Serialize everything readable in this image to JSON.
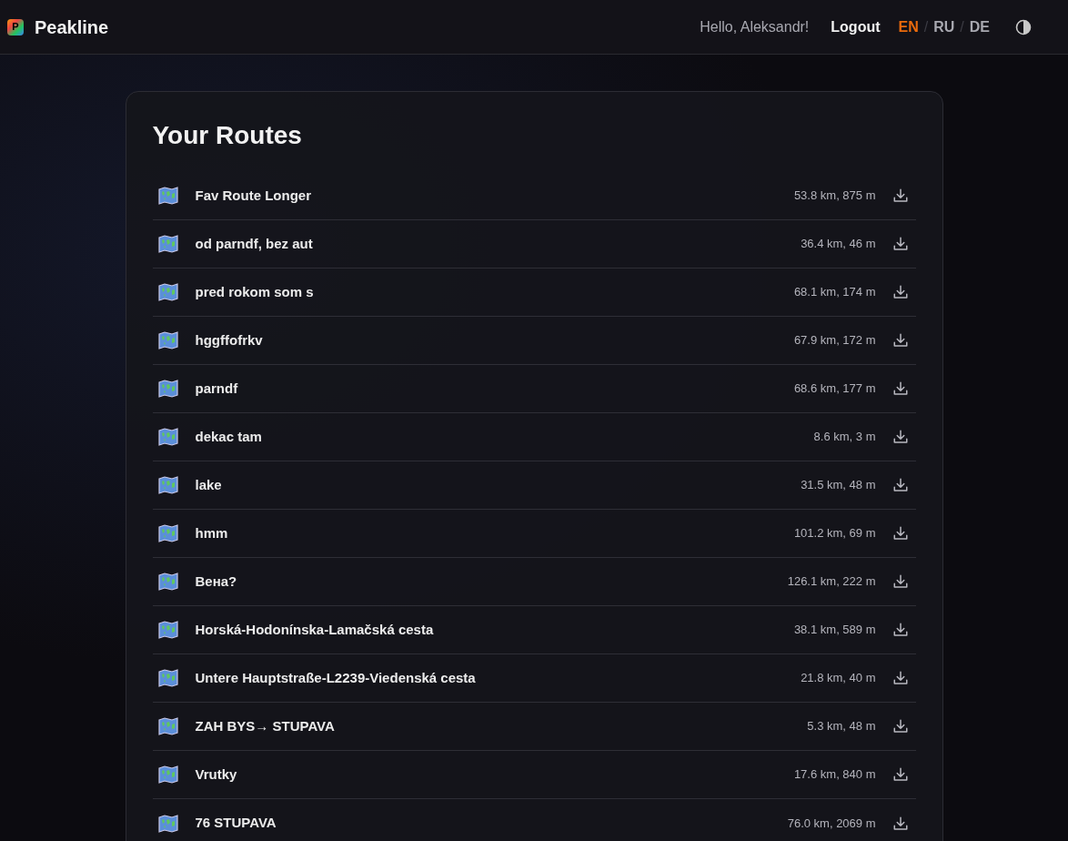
{
  "brand": {
    "name": "Peakline",
    "logo_letter": "P"
  },
  "header": {
    "greeting": "Hello, Aleksandr!",
    "logout": "Logout",
    "languages": [
      {
        "code": "EN",
        "selected": true
      },
      {
        "code": "RU",
        "selected": false
      },
      {
        "code": "DE",
        "selected": false
      }
    ],
    "language_separator": "/"
  },
  "routes": {
    "title": "Your Routes",
    "items": [
      {
        "name": "Fav Route Longer",
        "stats": "53.8 km, 875 m"
      },
      {
        "name": "od parndf, bez aut",
        "stats": "36.4 km, 46 m"
      },
      {
        "name": "pred rokom som s",
        "stats": "68.1 km, 174 m"
      },
      {
        "name": "hggffofrkv",
        "stats": "67.9 km, 172 m"
      },
      {
        "name": "parndf",
        "stats": "68.6 km, 177 m"
      },
      {
        "name": "dekac tam",
        "stats": "8.6 km, 3 m"
      },
      {
        "name": "lake",
        "stats": "31.5 km, 48 m"
      },
      {
        "name": "hmm",
        "stats": "101.2 km, 69 m"
      },
      {
        "name": "Вена?",
        "stats": "126.1 km, 222 m"
      },
      {
        "name": "Horská-Hodonínska-Lamačská cesta",
        "stats": "38.1 km, 589 m"
      },
      {
        "name": "Untere Hauptstraße-L2239-Viedenská cesta",
        "stats": "21.8 km, 40 m"
      },
      {
        "name": "ZAH BYS→ STUPAVA",
        "stats": "5.3 km, 48 m"
      },
      {
        "name": "Vrutky",
        "stats": "17.6 km, 840 m"
      },
      {
        "name": "76 STUPAVA",
        "stats": "76.0 km, 2069 m"
      }
    ]
  }
}
